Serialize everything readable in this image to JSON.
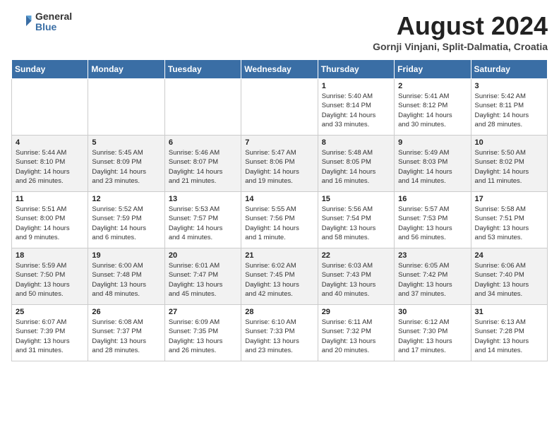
{
  "logo": {
    "general": "General",
    "blue": "Blue"
  },
  "title": "August 2024",
  "location": "Gornji Vinjani, Split-Dalmatia, Croatia",
  "days_of_week": [
    "Sunday",
    "Monday",
    "Tuesday",
    "Wednesday",
    "Thursday",
    "Friday",
    "Saturday"
  ],
  "weeks": [
    [
      {
        "day": "",
        "content": ""
      },
      {
        "day": "",
        "content": ""
      },
      {
        "day": "",
        "content": ""
      },
      {
        "day": "",
        "content": ""
      },
      {
        "day": "1",
        "content": "Sunrise: 5:40 AM\nSunset: 8:14 PM\nDaylight: 14 hours\nand 33 minutes."
      },
      {
        "day": "2",
        "content": "Sunrise: 5:41 AM\nSunset: 8:12 PM\nDaylight: 14 hours\nand 30 minutes."
      },
      {
        "day": "3",
        "content": "Sunrise: 5:42 AM\nSunset: 8:11 PM\nDaylight: 14 hours\nand 28 minutes."
      }
    ],
    [
      {
        "day": "4",
        "content": "Sunrise: 5:44 AM\nSunset: 8:10 PM\nDaylight: 14 hours\nand 26 minutes."
      },
      {
        "day": "5",
        "content": "Sunrise: 5:45 AM\nSunset: 8:09 PM\nDaylight: 14 hours\nand 23 minutes."
      },
      {
        "day": "6",
        "content": "Sunrise: 5:46 AM\nSunset: 8:07 PM\nDaylight: 14 hours\nand 21 minutes."
      },
      {
        "day": "7",
        "content": "Sunrise: 5:47 AM\nSunset: 8:06 PM\nDaylight: 14 hours\nand 19 minutes."
      },
      {
        "day": "8",
        "content": "Sunrise: 5:48 AM\nSunset: 8:05 PM\nDaylight: 14 hours\nand 16 minutes."
      },
      {
        "day": "9",
        "content": "Sunrise: 5:49 AM\nSunset: 8:03 PM\nDaylight: 14 hours\nand 14 minutes."
      },
      {
        "day": "10",
        "content": "Sunrise: 5:50 AM\nSunset: 8:02 PM\nDaylight: 14 hours\nand 11 minutes."
      }
    ],
    [
      {
        "day": "11",
        "content": "Sunrise: 5:51 AM\nSunset: 8:00 PM\nDaylight: 14 hours\nand 9 minutes."
      },
      {
        "day": "12",
        "content": "Sunrise: 5:52 AM\nSunset: 7:59 PM\nDaylight: 14 hours\nand 6 minutes."
      },
      {
        "day": "13",
        "content": "Sunrise: 5:53 AM\nSunset: 7:57 PM\nDaylight: 14 hours\nand 4 minutes."
      },
      {
        "day": "14",
        "content": "Sunrise: 5:55 AM\nSunset: 7:56 PM\nDaylight: 14 hours\nand 1 minute."
      },
      {
        "day": "15",
        "content": "Sunrise: 5:56 AM\nSunset: 7:54 PM\nDaylight: 13 hours\nand 58 minutes."
      },
      {
        "day": "16",
        "content": "Sunrise: 5:57 AM\nSunset: 7:53 PM\nDaylight: 13 hours\nand 56 minutes."
      },
      {
        "day": "17",
        "content": "Sunrise: 5:58 AM\nSunset: 7:51 PM\nDaylight: 13 hours\nand 53 minutes."
      }
    ],
    [
      {
        "day": "18",
        "content": "Sunrise: 5:59 AM\nSunset: 7:50 PM\nDaylight: 13 hours\nand 50 minutes."
      },
      {
        "day": "19",
        "content": "Sunrise: 6:00 AM\nSunset: 7:48 PM\nDaylight: 13 hours\nand 48 minutes."
      },
      {
        "day": "20",
        "content": "Sunrise: 6:01 AM\nSunset: 7:47 PM\nDaylight: 13 hours\nand 45 minutes."
      },
      {
        "day": "21",
        "content": "Sunrise: 6:02 AM\nSunset: 7:45 PM\nDaylight: 13 hours\nand 42 minutes."
      },
      {
        "day": "22",
        "content": "Sunrise: 6:03 AM\nSunset: 7:43 PM\nDaylight: 13 hours\nand 40 minutes."
      },
      {
        "day": "23",
        "content": "Sunrise: 6:05 AM\nSunset: 7:42 PM\nDaylight: 13 hours\nand 37 minutes."
      },
      {
        "day": "24",
        "content": "Sunrise: 6:06 AM\nSunset: 7:40 PM\nDaylight: 13 hours\nand 34 minutes."
      }
    ],
    [
      {
        "day": "25",
        "content": "Sunrise: 6:07 AM\nSunset: 7:39 PM\nDaylight: 13 hours\nand 31 minutes."
      },
      {
        "day": "26",
        "content": "Sunrise: 6:08 AM\nSunset: 7:37 PM\nDaylight: 13 hours\nand 28 minutes."
      },
      {
        "day": "27",
        "content": "Sunrise: 6:09 AM\nSunset: 7:35 PM\nDaylight: 13 hours\nand 26 minutes."
      },
      {
        "day": "28",
        "content": "Sunrise: 6:10 AM\nSunset: 7:33 PM\nDaylight: 13 hours\nand 23 minutes."
      },
      {
        "day": "29",
        "content": "Sunrise: 6:11 AM\nSunset: 7:32 PM\nDaylight: 13 hours\nand 20 minutes."
      },
      {
        "day": "30",
        "content": "Sunrise: 6:12 AM\nSunset: 7:30 PM\nDaylight: 13 hours\nand 17 minutes."
      },
      {
        "day": "31",
        "content": "Sunrise: 6:13 AM\nSunset: 7:28 PM\nDaylight: 13 hours\nand 14 minutes."
      }
    ]
  ]
}
